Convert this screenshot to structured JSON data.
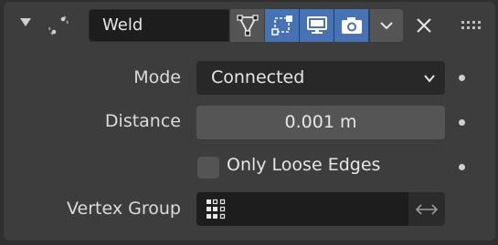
{
  "modifier": {
    "name": "Weld",
    "icons": {
      "collapse": "triangle-down-icon",
      "type": "weld-modifier-icon",
      "edit_mode": "edit-mode-icon",
      "on_cage": "on-cage-icon",
      "viewport": "monitor-icon",
      "render": "camera-icon",
      "dropdown": "chevron-down-icon",
      "remove": "close-icon",
      "drag": "grip-icon"
    },
    "toggles": {
      "edit_mode": false,
      "on_cage": true,
      "viewport": true,
      "render": true
    }
  },
  "properties": {
    "mode": {
      "label": "Mode",
      "value": "Connected"
    },
    "distance": {
      "label": "Distance",
      "value": "0.001 m"
    },
    "only_loose_edges": {
      "label": "Only Loose Edges",
      "checked": false
    },
    "vertex_group": {
      "label": "Vertex Group",
      "value": ""
    }
  },
  "colors": {
    "panel_bg": "#3d3d3d",
    "accent": "#4772b3",
    "field_dark": "#1d1d1d"
  }
}
